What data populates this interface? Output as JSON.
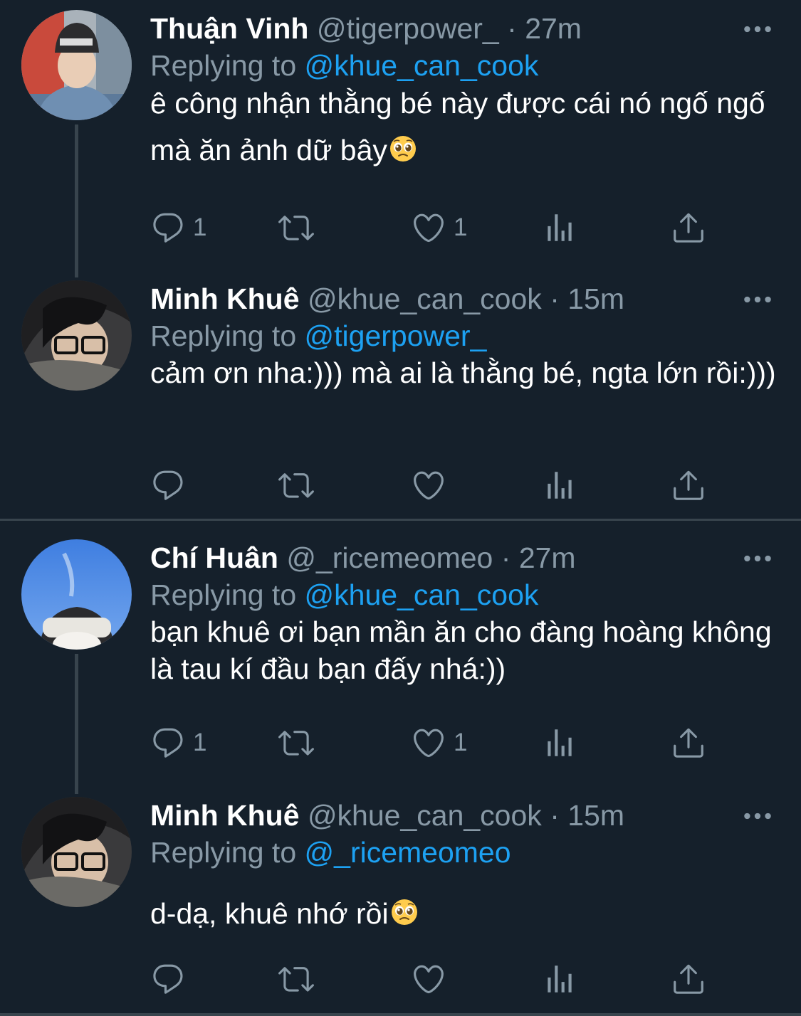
{
  "tweets": [
    {
      "name": "Thuận Vinh",
      "handle": "@tigerpower_",
      "separator": "·",
      "time": "27m",
      "replying_label": "Replying to",
      "replying_to": "@khue_can_cook",
      "text": "ê công nhận thằng bé này được cái nó ngố ngố mà ăn ảnh dữ bây",
      "emoji": "pleading-face-icon",
      "reply_count": "1",
      "retweet_count": "",
      "like_count": "1"
    },
    {
      "name": "Minh Khuê",
      "handle": "@khue_can_cook",
      "separator": "·",
      "time": "15m",
      "replying_label": "Replying to",
      "replying_to": "@tigerpower_",
      "text": "cảm ơn nha:))) mà ai là thằng bé, ngta lớn rồi:)))",
      "reply_count": "",
      "retweet_count": "",
      "like_count": ""
    },
    {
      "name": "Chí Huân",
      "handle": "@_ricemeomeo",
      "separator": "·",
      "time": "27m",
      "replying_label": "Replying to",
      "replying_to": "@khue_can_cook",
      "text": "bạn khuê ơi bạn mần ăn cho đàng hoàng không là tau kí đầu bạn đấy nhá:))",
      "reply_count": "1",
      "retweet_count": "",
      "like_count": "1"
    },
    {
      "name": "Minh Khuê",
      "handle": "@khue_can_cook",
      "separator": "·",
      "time": "15m",
      "replying_label": "Replying to",
      "replying_to": "@_ricemeomeo",
      "text": "d-dạ, khuê nhớ rồi",
      "emoji": "pleading-face-icon",
      "reply_count": "",
      "retweet_count": "",
      "like_count": ""
    }
  ],
  "colors": {
    "background": "#15202b",
    "secondary_text": "#8899a6",
    "mention": "#1da1f2",
    "divider": "#38444d"
  }
}
